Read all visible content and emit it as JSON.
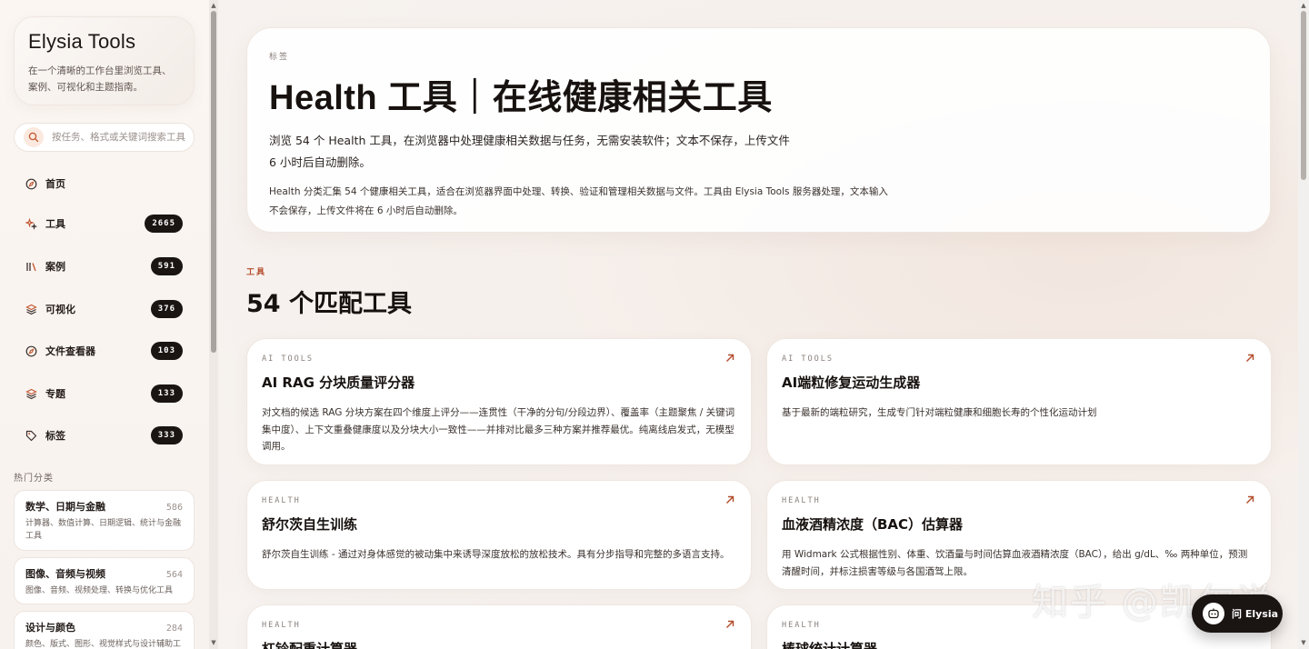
{
  "brand": {
    "title": "Elysia Tools",
    "subtitle": "在一个清晰的工作台里浏览工具、案例、可视化和主题指南。"
  },
  "search": {
    "placeholder": "按任务、格式或关键词搜索工具"
  },
  "nav": [
    {
      "label": "首页",
      "badge": "",
      "icon": "compass-icon"
    },
    {
      "label": "工具",
      "badge": "2665",
      "icon": "sparkle-icon"
    },
    {
      "label": "案例",
      "badge": "591",
      "icon": "library-icon"
    },
    {
      "label": "可视化",
      "badge": "376",
      "icon": "layers-icon"
    },
    {
      "label": "文件查看器",
      "badge": "103",
      "icon": "compass-icon"
    },
    {
      "label": "专题",
      "badge": "133",
      "icon": "layers-icon"
    },
    {
      "label": "标签",
      "badge": "333",
      "icon": "tag-icon"
    }
  ],
  "popular": {
    "label": "热门分类",
    "items": [
      {
        "name": "数学、日期与金融",
        "count": "586",
        "desc": "计算器、数值计算、日期逻辑、统计与金融工具"
      },
      {
        "name": "图像、音频与视频",
        "count": "564",
        "desc": "图像、音频、视频处理、转换与优化工具"
      },
      {
        "name": "设计与颜色",
        "count": "284",
        "desc": "颜色、版式、图形、视觉样式与设计辅助工具"
      }
    ]
  },
  "hero": {
    "kicker": "标签",
    "title": "Health 工具｜在线健康相关工具",
    "lead": "浏览 54 个 Health 工具，在浏览器中处理健康相关数据与任务，无需安装软件；文本不保存，上传文件 6 小时后自动删除。",
    "desc": "Health 分类汇集 54 个健康相关工具，适合在浏览器界面中处理、转换、验证和管理相关数据与文件。工具由 Elysia Tools 服务器处理，文本输入不会保存，上传文件将在 6 小时后自动删除。"
  },
  "tools_section": {
    "kicker": "工具",
    "title": "54 个匹配工具"
  },
  "cards": [
    {
      "kicker": "AI TOOLS",
      "title": "AI RAG 分块质量评分器",
      "desc": "对文档的候选 RAG 分块方案在四个维度上评分——连贯性（干净的分句/分段边界）、覆盖率（主题聚焦 / 关键词集中度）、上下文重叠健康度以及分块大小一致性——并排对比最多三种方案并推荐最优。纯离线启发式，无模型调用。"
    },
    {
      "kicker": "AI TOOLS",
      "title": "AI端粒修复运动生成器",
      "desc": "基于最新的端粒研究，生成专门针对端粒健康和细胞长寿的个性化运动计划"
    },
    {
      "kicker": "HEALTH",
      "title": "舒尔茨自生训练",
      "desc": "舒尔茨自生训练 - 通过对身体感觉的被动集中来诱导深度放松的放松技术。具有分步指导和完整的多语言支持。"
    },
    {
      "kicker": "HEALTH",
      "title": "血液酒精浓度（BAC）估算器",
      "desc": "用 Widmark 公式根据性别、体重、饮酒量与时间估算血液酒精浓度（BAC），给出 g/dL、‰ 两种单位，预测清醒时间，并标注损害等级与各国酒驾上限。"
    },
    {
      "kicker": "HEALTH",
      "title": "杠铃配重计算器",
      "desc": ""
    },
    {
      "kicker": "HEALTH",
      "title": "棒球统计计算器",
      "desc": ""
    }
  ],
  "ask": {
    "label": "问 Elysia"
  },
  "watermark": "知乎 @凯尔说",
  "colors": {
    "accent": "#b34b2a",
    "badge": "#1a1412"
  }
}
